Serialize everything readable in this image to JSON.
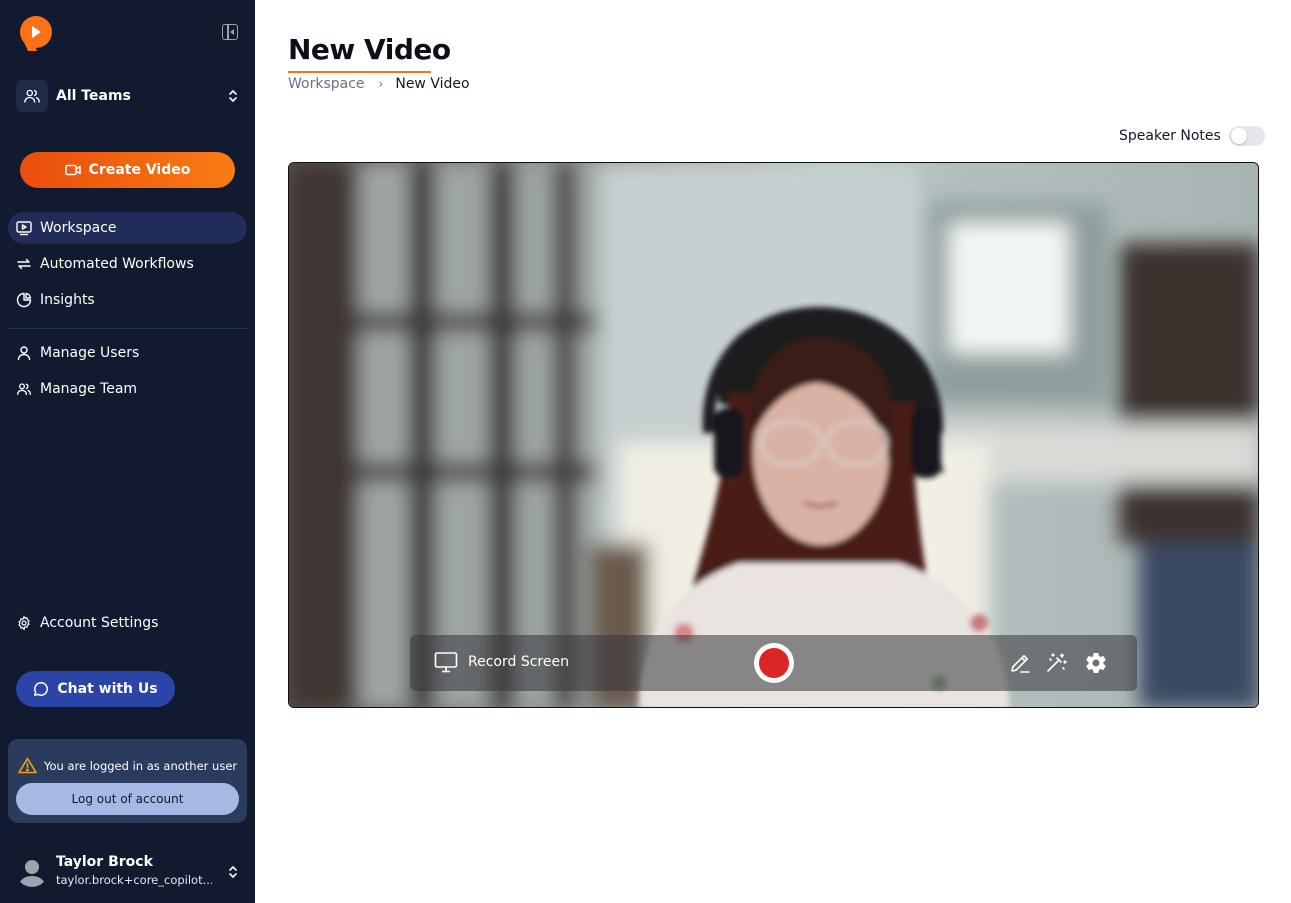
{
  "sidebar": {
    "team_select": {
      "label": "All Teams"
    },
    "create_button": {
      "label": "Create Video"
    },
    "nav": [
      {
        "label": "Workspace",
        "active": true
      },
      {
        "label": "Automated Workflows"
      },
      {
        "label": "Insights"
      },
      {
        "label": "Manage Users"
      },
      {
        "label": "Manage Team"
      }
    ],
    "account_settings": {
      "label": "Account Settings"
    },
    "chat_button": {
      "label": "Chat with Us"
    },
    "impersonation": {
      "message": "You are logged in as another user",
      "logout_label": "Log out of account"
    },
    "user": {
      "name": "Taylor Brock",
      "email": "taylor.brock+core_copilot..."
    }
  },
  "main": {
    "title": "New Video",
    "breadcrumb": [
      "Workspace",
      "New Video"
    ],
    "speaker_notes": {
      "label": "Speaker Notes",
      "enabled": false
    },
    "recorder": {
      "record_screen_label": "Record Screen"
    }
  },
  "colors": {
    "sidebar_bg": "#111a2e",
    "accent_orange": "#f97316",
    "active_nav": "#1f2d58",
    "chat_button": "#2a44a8",
    "record_red": "#dc2626"
  },
  "icons": [
    "logo-icon",
    "collapse-sidebar-icon",
    "users-icon",
    "chevron-updown-icon",
    "video-camera-icon",
    "monitor-play-icon",
    "arrows-repeat-icon",
    "pie-chart-icon",
    "user-icon",
    "gear-icon",
    "chat-bubble-icon",
    "warning-icon",
    "monitor-icon",
    "record-icon",
    "pencil-icon",
    "magic-wand-icon"
  ]
}
